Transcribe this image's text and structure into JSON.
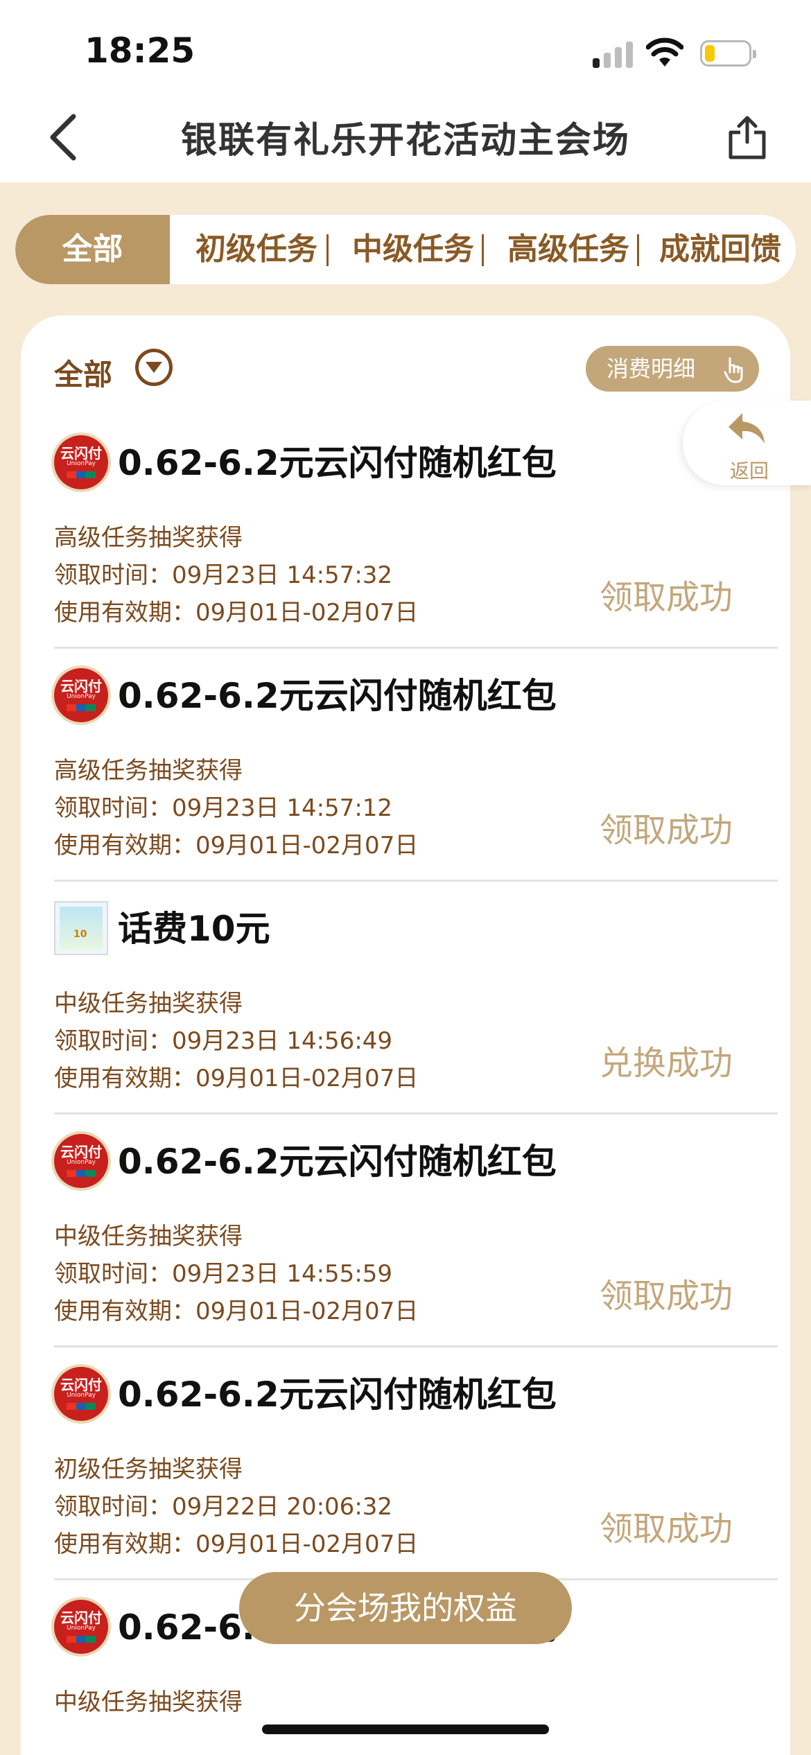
{
  "status_bar": {
    "time": "18:25"
  },
  "nav": {
    "title": "银联有礼乐开花活动主会场"
  },
  "tabs": [
    {
      "label": "全部",
      "active": true
    },
    {
      "label": "初级任务"
    },
    {
      "label": "中级任务"
    },
    {
      "label": "高级任务"
    },
    {
      "label": "成就回馈"
    }
  ],
  "filter": {
    "label": "全部"
  },
  "detail_button": {
    "label": "消费明细"
  },
  "return_button": {
    "label": "返回"
  },
  "logo_text": {
    "cn": "云闪付",
    "en": "UnionPay",
    "card_value": "10"
  },
  "items": [
    {
      "icon": "unionpay-logo",
      "name": "0.62-6.2元云闪付随机红包",
      "source": "高级任务抽奖获得",
      "receive_time": "领取时间：09月23日 14:57:32",
      "validity": "使用有效期：09月01日-02月07日",
      "status": "领取成功"
    },
    {
      "icon": "unionpay-logo",
      "name": "0.62-6.2元云闪付随机红包",
      "source": "高级任务抽奖获得",
      "receive_time": "领取时间：09月23日 14:57:12",
      "validity": "使用有效期：09月01日-02月07日",
      "status": "领取成功"
    },
    {
      "icon": "phone-credit-card",
      "name": "话费10元",
      "source": "中级任务抽奖获得",
      "receive_time": "领取时间：09月23日 14:56:49",
      "validity": "使用有效期：09月01日-02月07日",
      "status": "兑换成功"
    },
    {
      "icon": "unionpay-logo",
      "name": "0.62-6.2元云闪付随机红包",
      "source": "中级任务抽奖获得",
      "receive_time": "领取时间：09月23日 14:55:59",
      "validity": "使用有效期：09月01日-02月07日",
      "status": "领取成功"
    },
    {
      "icon": "unionpay-logo",
      "name": "0.62-6.2元云闪付随机红包",
      "source": "初级任务抽奖获得",
      "receive_time": "领取时间：09月22日 20:06:32",
      "validity": "使用有效期：09月01日-02月07日",
      "status": "领取成功"
    },
    {
      "icon": "unionpay-logo",
      "name": "0.62-6.2元云闪付随机红包",
      "source": "中级任务抽奖获得"
    }
  ],
  "bottom_button": {
    "label": "分会场我的权益"
  },
  "colors": {
    "accent": "#b99866",
    "brown_text": "#7b4a1e",
    "status_text": "#c3a77b",
    "page_bg": "#f6ead4"
  }
}
